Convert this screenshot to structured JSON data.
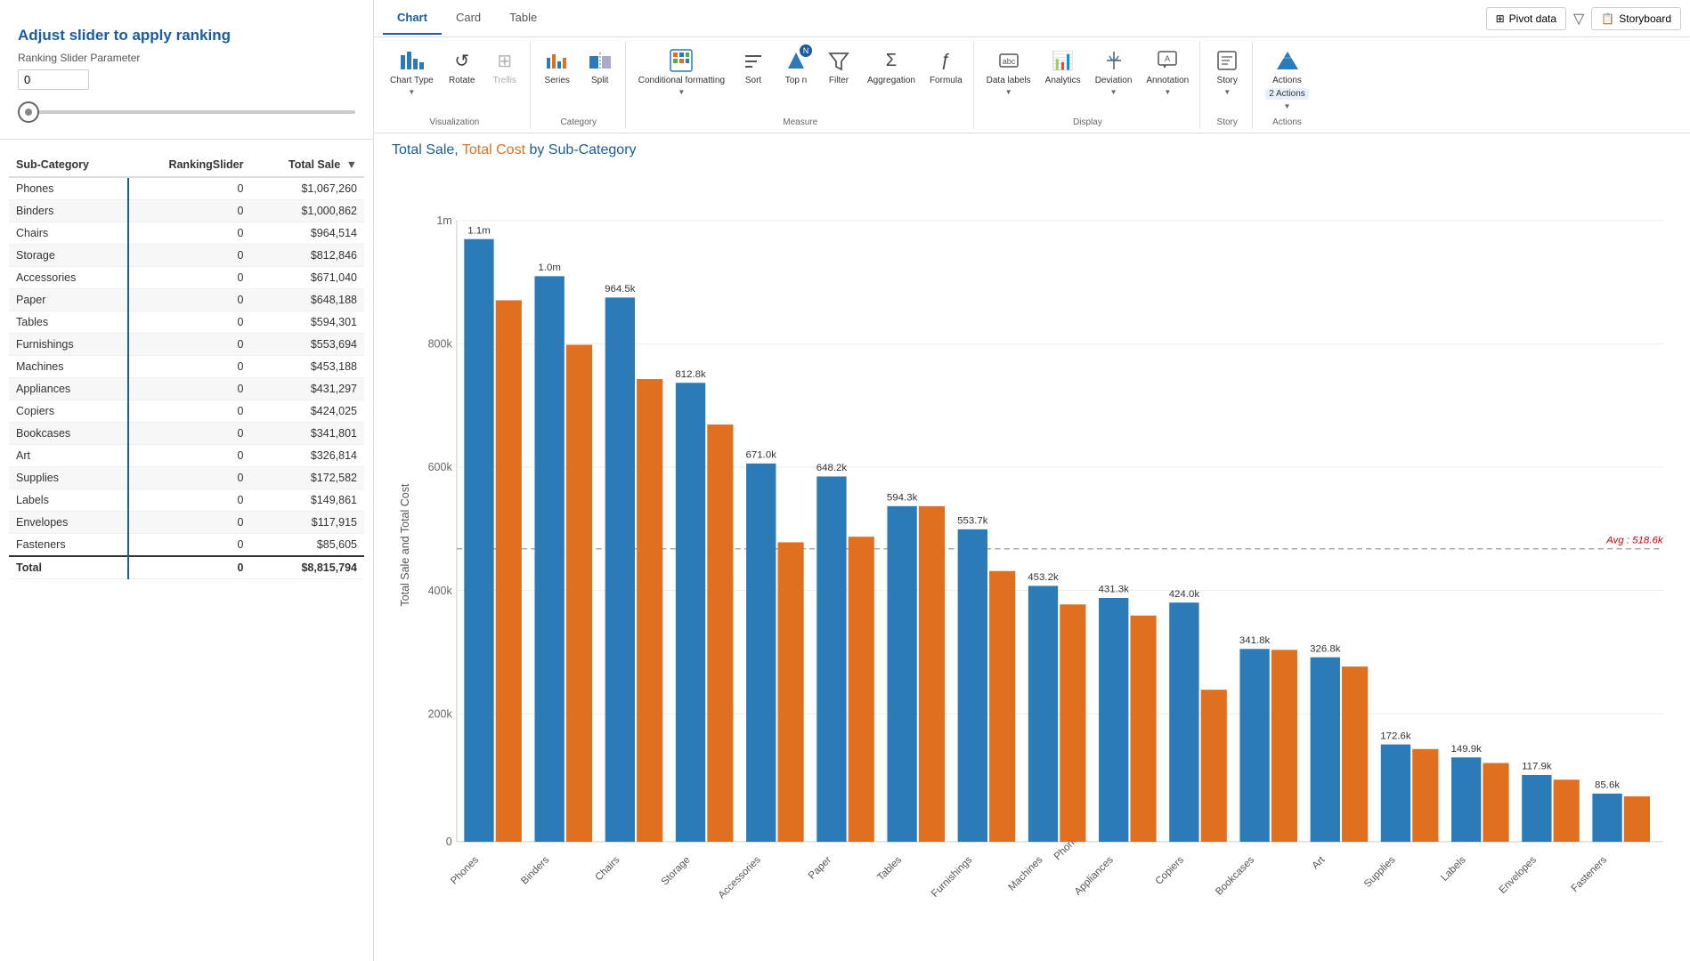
{
  "tabs": [
    {
      "label": "Chart",
      "active": true
    },
    {
      "label": "Card",
      "active": false
    },
    {
      "label": "Table",
      "active": false
    }
  ],
  "pivotBtn": {
    "label": "Pivot data",
    "icon": "⊞"
  },
  "storyboardBtn": {
    "label": "Storyboard",
    "icon": "📋"
  },
  "toolbar": {
    "visualization": {
      "label": "Visualization",
      "items": [
        {
          "label": "Chart Type",
          "icon": "bar",
          "arrow": true
        },
        {
          "label": "Rotate",
          "icon": "rotate"
        },
        {
          "label": "Trellis",
          "icon": "trellis",
          "disabled": true
        }
      ]
    },
    "category": {
      "label": "Category",
      "items": [
        {
          "label": "Series",
          "icon": "series"
        },
        {
          "label": "Split",
          "icon": "split"
        }
      ]
    },
    "measure": {
      "label": "Measure",
      "items": [
        {
          "label": "Conditional formatting",
          "icon": "cond",
          "arrow": true
        },
        {
          "label": "Sort",
          "icon": "sort"
        },
        {
          "label": "Top n",
          "icon": "topn",
          "badge": true
        },
        {
          "label": "Filter",
          "icon": "filter"
        },
        {
          "label": "Aggregation",
          "icon": "aggregation"
        },
        {
          "label": "Formula",
          "icon": "formula"
        }
      ]
    },
    "display": {
      "label": "Display",
      "items": [
        {
          "label": "Data labels",
          "icon": "datalabels",
          "arrow": true
        },
        {
          "label": "Analytics",
          "icon": "analytics"
        },
        {
          "label": "Deviation",
          "icon": "deviation",
          "arrow": true
        },
        {
          "label": "Annotation",
          "icon": "annotation",
          "arrow": true
        }
      ]
    },
    "story": {
      "label": "Story",
      "items": []
    },
    "actions": {
      "label": "Actions",
      "count": "2 Actions",
      "arrow": true
    }
  },
  "chartTitle": {
    "part1": "Total Sale",
    "separator": ", ",
    "part2": "Total Cost",
    "suffix": " by Sub-Category"
  },
  "chartYLabel": "Total Sale and Total Cost",
  "avgLabel": "Avg : 518.6k",
  "yAxis": {
    "labels": [
      "1m",
      "800k",
      "600k",
      "400k",
      "200k",
      "0"
    ]
  },
  "xAxis": {
    "labels": [
      "Phones",
      "Binders",
      "Chairs",
      "Storage",
      "Accessories",
      "Paper",
      "Tables",
      "Furnishings",
      "Machines",
      "Appliances",
      "Copiers",
      "Bookcases",
      "Art",
      "Supplies",
      "Labels",
      "Envelopes",
      "Fasteners"
    ]
  },
  "bars": [
    {
      "category": "Phones",
      "totalSale": 1067260,
      "totalCost": 960000,
      "saleLabel": "1.1m",
      "costLabel": ""
    },
    {
      "category": "Binders",
      "totalSale": 1000862,
      "totalCost": 880000,
      "saleLabel": "1.0m",
      "costLabel": ""
    },
    {
      "category": "Chairs",
      "totalSale": 964514,
      "totalCost": 820000,
      "saleLabel": "964.5k",
      "costLabel": ""
    },
    {
      "category": "Storage",
      "totalSale": 812846,
      "totalCost": 740000,
      "saleLabel": "812.8k",
      "costLabel": ""
    },
    {
      "category": "Accessories",
      "totalSale": 671040,
      "totalCost": 530000,
      "saleLabel": "671.0k",
      "costLabel": ""
    },
    {
      "category": "Paper",
      "totalSale": 648188,
      "totalCost": 540000,
      "saleLabel": "648.2k",
      "costLabel": ""
    },
    {
      "category": "Tables",
      "totalSale": 594301,
      "totalCost": 594300,
      "saleLabel": "594.3k",
      "costLabel": ""
    },
    {
      "category": "Furnishings",
      "totalSale": 553694,
      "totalCost": 480000,
      "saleLabel": "553.7k",
      "costLabel": ""
    },
    {
      "category": "Machines",
      "totalSale": 453188,
      "totalCost": 420000,
      "saleLabel": "453.2k",
      "costLabel": ""
    },
    {
      "category": "Appliances",
      "totalSale": 431297,
      "totalCost": 400000,
      "saleLabel": "431.3k",
      "costLabel": ""
    },
    {
      "category": "Copiers",
      "totalSale": 424025,
      "totalCost": 270000,
      "saleLabel": "424.0k",
      "costLabel": ""
    },
    {
      "category": "Bookcases",
      "totalSale": 341801,
      "totalCost": 341000,
      "saleLabel": "341.8k",
      "costLabel": ""
    },
    {
      "category": "Art",
      "totalSale": 326814,
      "totalCost": 310000,
      "saleLabel": "326.8k",
      "costLabel": ""
    },
    {
      "category": "Supplies",
      "totalSale": 172582,
      "totalCost": 165000,
      "saleLabel": "172.6k",
      "costLabel": ""
    },
    {
      "category": "Labels",
      "totalSale": 149861,
      "totalCost": 140000,
      "saleLabel": "149.9k",
      "costLabel": ""
    },
    {
      "category": "Envelopes",
      "totalSale": 117915,
      "totalCost": 110000,
      "saleLabel": "117.9k",
      "costLabel": ""
    },
    {
      "category": "Fasteners",
      "totalSale": 85605,
      "totalCost": 80000,
      "saleLabel": "85.6k",
      "costLabel": ""
    }
  ],
  "sliderSection": {
    "title": "Adjust slider to apply ranking",
    "paramLabel": "Ranking Slider Parameter",
    "value": "0"
  },
  "tableData": {
    "headers": [
      "Sub-Category",
      "RankingSlider",
      "Total Sale"
    ],
    "rows": [
      {
        "subCategory": "Phones",
        "rankingSlider": 0,
        "totalSale": "$1,067,260"
      },
      {
        "subCategory": "Binders",
        "rankingSlider": 0,
        "totalSale": "$1,000,862"
      },
      {
        "subCategory": "Chairs",
        "rankingSlider": 0,
        "totalSale": "$964,514"
      },
      {
        "subCategory": "Storage",
        "rankingSlider": 0,
        "totalSale": "$812,846"
      },
      {
        "subCategory": "Accessories",
        "rankingSlider": 0,
        "totalSale": "$671,040"
      },
      {
        "subCategory": "Paper",
        "rankingSlider": 0,
        "totalSale": "$648,188"
      },
      {
        "subCategory": "Tables",
        "rankingSlider": 0,
        "totalSale": "$594,301"
      },
      {
        "subCategory": "Furnishings",
        "rankingSlider": 0,
        "totalSale": "$553,694"
      },
      {
        "subCategory": "Machines",
        "rankingSlider": 0,
        "totalSale": "$453,188"
      },
      {
        "subCategory": "Appliances",
        "rankingSlider": 0,
        "totalSale": "$431,297"
      },
      {
        "subCategory": "Copiers",
        "rankingSlider": 0,
        "totalSale": "$424,025"
      },
      {
        "subCategory": "Bookcases",
        "rankingSlider": 0,
        "totalSale": "$341,801"
      },
      {
        "subCategory": "Art",
        "rankingSlider": 0,
        "totalSale": "$326,814"
      },
      {
        "subCategory": "Supplies",
        "rankingSlider": 0,
        "totalSale": "$172,582"
      },
      {
        "subCategory": "Labels",
        "rankingSlider": 0,
        "totalSale": "$149,861"
      },
      {
        "subCategory": "Envelopes",
        "rankingSlider": 0,
        "totalSale": "$117,915"
      },
      {
        "subCategory": "Fasteners",
        "rankingSlider": 0,
        "totalSale": "$85,605"
      }
    ],
    "total": {
      "subCategory": "Total",
      "rankingSlider": 0,
      "totalSale": "$8,815,794"
    }
  },
  "colors": {
    "blue": "#2b7bb9",
    "orange": "#e07020",
    "accent": "#1a5c9e",
    "avgLine": "#999"
  }
}
